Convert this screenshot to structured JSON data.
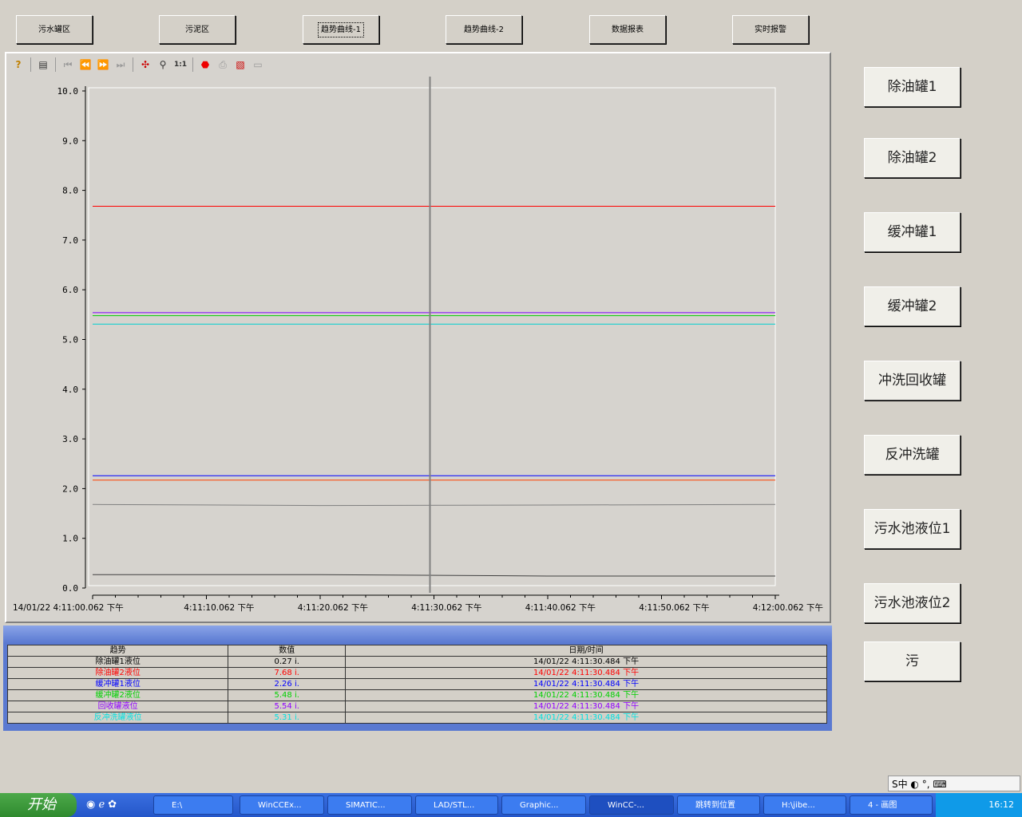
{
  "nav": [
    "污水罐区",
    "污泥区",
    "趋势曲线-1",
    "趋势曲线-2",
    "数据报表",
    "实时报警"
  ],
  "side": [
    "除油罐1",
    "除油罐2",
    "缓冲罐1",
    "缓冲罐2",
    "冲洗回收罐",
    "反冲洗罐",
    "污水池液位1",
    "污水池液位2",
    "污"
  ],
  "toolbar_icons": [
    "help-icon",
    "config-icon",
    "first-icon",
    "prev-icon",
    "next-icon",
    "last-icon",
    "ruler-icon",
    "zoom-icon",
    "original-icon",
    "stop-icon",
    "print-icon",
    "chart-icon",
    "export-icon"
  ],
  "chart_data": {
    "type": "line",
    "y_ticks": [
      "10.0",
      "9.0",
      "8.0",
      "7.0",
      "6.0",
      "5.0",
      "4.0",
      "3.0",
      "2.0",
      "1.0",
      "0.0"
    ],
    "ylim": [
      0,
      10
    ],
    "x_ticks": [
      "4:11:00.062 下午",
      "4:11:10.062 下午",
      "4:11:20.062 下午",
      "4:11:30.062 下午",
      "4:11:40.062 下午",
      "4:11:50.062 下午",
      "4:12:00.062 下午"
    ],
    "x_date": "14/01/22",
    "ruler_index": 3,
    "series": [
      {
        "color": "#ff0000",
        "values": [
          7.68,
          7.68
        ]
      },
      {
        "color": "#8000ff",
        "values": [
          5.54,
          5.54
        ]
      },
      {
        "color": "#00cc00",
        "values": [
          5.48,
          5.48
        ]
      },
      {
        "color": "#00d0d0",
        "values": [
          5.31,
          5.31
        ]
      },
      {
        "color": "#0000ff",
        "values": [
          2.26,
          2.26
        ]
      },
      {
        "color": "#ff4000",
        "values": [
          2.17,
          2.17
        ]
      },
      {
        "color": "#808080",
        "values": [
          1.68,
          1.66,
          1.67,
          1.68
        ]
      },
      {
        "color": "#404040",
        "values": [
          0.27,
          0.27,
          0.24,
          0.24
        ]
      }
    ]
  },
  "table": {
    "headers": [
      "趋势",
      "数值",
      "日期/时间"
    ],
    "rows": [
      {
        "name": "除油罐1液位",
        "value": "0.27 i.",
        "time": "14/01/22 4:11:30.484 下午",
        "color": "#000000"
      },
      {
        "name": "除油罐2液位",
        "value": "7.68 i.",
        "time": "14/01/22 4:11:30.484 下午",
        "color": "#ff0000"
      },
      {
        "name": "缓冲罐1液位",
        "value": "2.26 i.",
        "time": "14/01/22 4:11:30.484 下午",
        "color": "#0000ff"
      },
      {
        "name": "缓冲罐2液位",
        "value": "5.48 i.",
        "time": "14/01/22 4:11:30.484 下午",
        "color": "#00d000"
      },
      {
        "name": "回收罐液位",
        "value": "5.54 i.",
        "time": "14/01/22 4:11:30.484 下午",
        "color": "#9000ff"
      },
      {
        "name": "反冲洗罐液位",
        "value": "5.31 i.",
        "time": "14/01/22 4:11:30.484 下午",
        "color": "#00e0e0"
      }
    ]
  },
  "taskbar": {
    "start": "开始",
    "items": [
      "E:\\",
      "WinCCEx...",
      "SIMATIC...",
      "LAD/STL...",
      "Graphic...",
      "WinCC-...",
      "跳转到位置",
      "H:\\jibe...",
      "4 - 画图"
    ],
    "clock": "16:12"
  },
  "ime": "S中 ◐ °, ⌨"
}
